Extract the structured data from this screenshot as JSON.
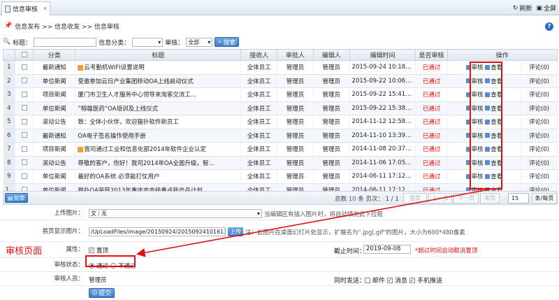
{
  "tab": {
    "label": "信息审核"
  },
  "topright": {
    "refresh": "刷新",
    "fullscreen": "全屏"
  },
  "breadcrumb": "信息发布 >> 信息收发 >> 信息审核",
  "filter": {
    "title_label": "标题：",
    "category_label": "信息分类：",
    "audit_label": "审核：",
    "audit_value": "全部",
    "search_button": "搜索"
  },
  "table": {
    "headers": [
      "分类",
      "标题",
      "接收人",
      "审批人",
      "编辑人",
      "编辑时间",
      "是否审核",
      "操作"
    ],
    "rows": [
      {
        "no": "1",
        "category": "最新通知",
        "flag": true,
        "title": "云考勤机WIFI设置说明",
        "receiver": "全体员工",
        "approver": "管理员",
        "editor": "管理员",
        "time": "2015-09-24 10:18:28",
        "status": "已通过",
        "audit": "审核",
        "view": "查看",
        "comment": "评论(0)"
      },
      {
        "no": "2",
        "category": "单位新闻",
        "flag": false,
        "title": "受邀参加云日产业集团移动OA上线启动仪式",
        "receiver": "全体员工",
        "approver": "管理员",
        "editor": "管理员",
        "time": "2015-09-22 10:06:27",
        "status": "已通过",
        "audit": "审核",
        "view": "查看",
        "comment": "评论(0)"
      },
      {
        "no": "3",
        "category": "项目新闻",
        "flag": false,
        "title": "厦门市卫生人才服务中心领导来淘客交流工...",
        "receiver": "全体员工",
        "approver": "管理员",
        "editor": "管理员",
        "time": "2015-09-22 15:41:07",
        "status": "已通过",
        "audit": "审核",
        "view": "查看",
        "comment": "评论(0)"
      },
      {
        "no": "4",
        "category": "单位新闻",
        "flag": false,
        "title": "”榕雄医药“OA培训及上线仪式",
        "receiver": "全体员工",
        "approver": "管理员",
        "editor": "管理员",
        "time": "2015-09-22 15:38:57",
        "status": "已通过",
        "audit": "审核",
        "view": "查看",
        "comment": "评论(0)"
      },
      {
        "no": "5",
        "category": "滚动公告",
        "flag": false,
        "title": "致：全体小伙伴，欢迎猫扑软件新员工",
        "receiver": "全体员工",
        "approver": "管理员",
        "editor": "管理员",
        "time": "2014-11-12 12:58:54",
        "status": "已通过",
        "audit": "审核",
        "view": "查看",
        "comment": "评论(0)"
      },
      {
        "no": "6",
        "category": "最新通知",
        "flag": false,
        "title": "OA电子签名操作使用手册",
        "receiver": "全体员工",
        "approver": "管理员",
        "editor": "管理员",
        "time": "2014-11-10 13:39:15",
        "status": "已通过",
        "audit": "审核",
        "view": "查看",
        "comment": "评论(0)"
      },
      {
        "no": "7",
        "category": "项目新闻",
        "flag": true,
        "title": "我司通过工业和信息化部2014年软件企业认定",
        "receiver": "全体员工",
        "approver": "管理员",
        "editor": "管理员",
        "time": "2014-11-08 20:37:05",
        "status": "已通过",
        "audit": "审核",
        "view": "查看",
        "comment": "评论(0)"
      },
      {
        "no": "8",
        "category": "滚动公告",
        "flag": false,
        "title": "尊敬的客户，你好！我司2014年OA全面升级，智...",
        "receiver": "全体员工",
        "approver": "管理员",
        "editor": "管理员",
        "time": "2014-11-06 17:05:57",
        "status": "已通过",
        "audit": "审核",
        "view": "查看",
        "comment": "评论(0)"
      },
      {
        "no": "9",
        "category": "单位新闻",
        "flag": false,
        "title": "最好的OA系统 必须能打仗用户",
        "receiver": "全体员工",
        "approver": "管理员",
        "editor": "管理员",
        "time": "2014-06-11 17:12:20",
        "status": "已通过",
        "audit": "审核",
        "view": "查看",
        "comment": "评论(0)"
      },
      {
        "no": "10",
        "category": "单位新闻",
        "flag": false,
        "title": "猫扑OA荣获2013年重庆市市级重点新产品计划...",
        "receiver": "全体员工",
        "approver": "管理员",
        "editor": "管理员",
        "time": "2014-06-11 17:12:28",
        "status": "已通过",
        "audit": "审核",
        "view": "查看",
        "comment": "评论(0)"
      }
    ]
  },
  "footer": {
    "batch": "批审",
    "total_prefix": "总数",
    "total": "10",
    "total_mid": "条 页次：",
    "pages": "1 / 1",
    "first": "首页",
    "prev": "上一页",
    "next": "下一页",
    "last": "末页",
    "page_size": "15",
    "per_page": "条/每页"
  },
  "form": {
    "upload_label": "上传图片：",
    "upload_prefix": "文",
    "upload_value": "无",
    "upload_hint": "当编辑区有插入图片时，将自动填充此下拉框",
    "display_label": "首页显示图片：",
    "display_path": "/UpLoadFiles/image/20150924/20150924101613_59",
    "display_btn": "上传",
    "display_hint": "注：此图片在桌面幻灯片处显示，扩展名为\".jpg|.gif\"的图片，大小为600*480像素",
    "attr_label": "属性：",
    "attr_option": "置顶",
    "deadline_label": "截止时间：",
    "deadline_value": "2019-09-08",
    "deadline_hint": "*超过时间自动取消置顶",
    "audit_label": "审核状态：",
    "audit_pass": "通过",
    "audit_fail": "不通过",
    "auditor_label": "审核人员：",
    "auditor_value": "管理员",
    "sync_label": "同时发送：",
    "sync_mail": "邮件",
    "sync_msg": "消息",
    "sync_sms": "手机推送",
    "submit": "提交"
  },
  "annotation": {
    "label": "审核页面",
    "color": "#e01010"
  }
}
